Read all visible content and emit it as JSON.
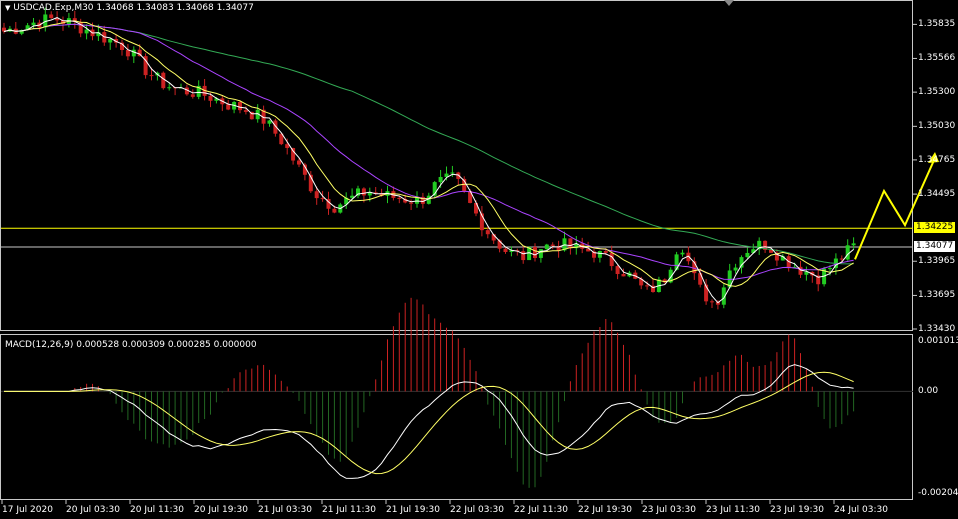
{
  "header": {
    "arrow": "▼",
    "symbol_info": "USDCAD.Exp,M30  1.34068 1.34083 1.34068 1.34077"
  },
  "macd": {
    "label": "MACD(12,26,9) 0.000528 0.000309 0.000285 0.000000",
    "axis": [
      "0.001013",
      "0.00",
      "-0.002042"
    ]
  },
  "price_axis": [
    "1.35835",
    "1.35566",
    "1.35300",
    "1.35030",
    "1.34765",
    "1.34495",
    "1.33965",
    "1.33695",
    "1.33430"
  ],
  "price_markers": {
    "yellow_line": "1.34225",
    "current_price": "1.34077"
  },
  "time_axis": [
    "17 Jul 2020",
    "20 Jul 03:30",
    "20 Jul 11:30",
    "20 Jul 19:30",
    "21 Jul 03:30",
    "21 Jul 11:30",
    "21 Jul 19:30",
    "22 Jul 03:30",
    "22 Jul 11:30",
    "22 Jul 19:30",
    "23 Jul 03:30",
    "23 Jul 11:30",
    "23 Jul 19:30",
    "24 Jul 03:30"
  ],
  "colors": {
    "bull_candle": "#22cc22",
    "bear_candle": "#cc2222",
    "ma_fast": "#ffffff",
    "ma_mid": "#ffff66",
    "ma_slow": "#aa44ff",
    "ma_long": "#33aa55",
    "level_line": "#ffff00",
    "forecast_arrow": "#ffff00",
    "macd_pos": "#cc2222",
    "macd_neg": "#226622"
  },
  "chart_data": {
    "type": "candlestick",
    "symbol": "USDCAD.Exp",
    "timeframe": "M30",
    "ylim": [
      1.3343,
      1.3598
    ],
    "x_axis_labels": [
      "17 Jul 2020",
      "20 Jul 03:30",
      "20 Jul 11:30",
      "20 Jul 19:30",
      "21 Jul 03:30",
      "21 Jul 11:30",
      "21 Jul 19:30",
      "22 Jul 03:30",
      "22 Jul 11:30",
      "22 Jul 19:30",
      "23 Jul 03:30",
      "23 Jul 11:30",
      "23 Jul 19:30",
      "24 Jul 03:30"
    ],
    "close_path": [
      1.3578,
      1.3582,
      1.3586,
      1.3588,
      1.3584,
      1.3578,
      1.3572,
      1.3566,
      1.355,
      1.3538,
      1.3532,
      1.353,
      1.3526,
      1.352,
      1.3516,
      1.3508,
      1.3492,
      1.347,
      1.345,
      1.344,
      1.3446,
      1.3452,
      1.3448,
      1.3446,
      1.3444,
      1.3458,
      1.3462,
      1.3438,
      1.3418,
      1.3404,
      1.34,
      1.3408,
      1.341,
      1.3406,
      1.3404,
      1.3396,
      1.3386,
      1.3372,
      1.338,
      1.3414,
      1.3376,
      1.3362,
      1.3394,
      1.3408,
      1.341,
      1.3398,
      1.339,
      1.3384,
      1.3396,
      1.3408
    ],
    "levels": {
      "yellow": 1.34225,
      "current": 1.34077
    },
    "forecast_path": [
      1.3398,
      1.3452,
      1.3425,
      1.3478
    ]
  }
}
